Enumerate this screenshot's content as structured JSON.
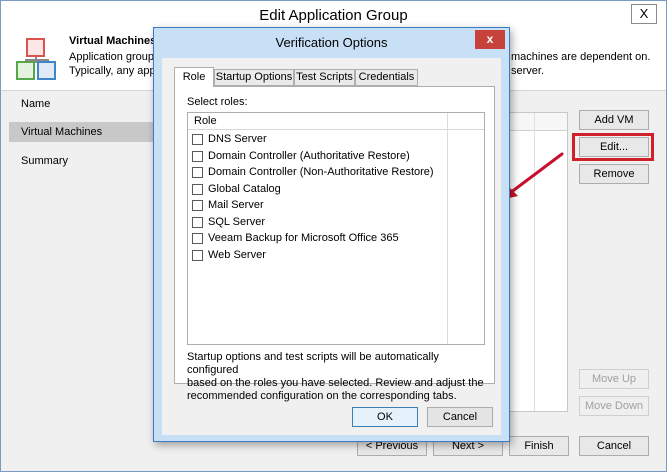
{
  "window": {
    "title": "Edit Application Group",
    "close_glyph": "X"
  },
  "header": {
    "title": "Virtual Machines",
    "description_line1": "Application group",
    "description_line2": "Typically, any appl",
    "description_right1": "machines are dependent on.",
    "description_right2": "server.",
    "icon": "application-group-icon"
  },
  "nav": {
    "items": [
      {
        "label": "Name"
      },
      {
        "label": "Virtual Machines",
        "selected": true
      },
      {
        "label": "Summary"
      }
    ]
  },
  "side_buttons": {
    "add_vm": "Add VM",
    "edit": "Edit...",
    "remove": "Remove",
    "move_up": "Move Up",
    "move_down": "Move Down"
  },
  "footer": {
    "previous": "< Previous",
    "next": "Next >",
    "finish": "Finish",
    "cancel": "Cancel"
  },
  "annotation": {
    "highlight_color": "#d0202a",
    "arrow_color": "#c8102e"
  },
  "dialog": {
    "title": "Verification Options",
    "close_glyph": "x",
    "tabs": [
      {
        "label": "Role",
        "active": true
      },
      {
        "label": "Startup Options"
      },
      {
        "label": "Test Scripts"
      },
      {
        "label": "Credentials"
      }
    ],
    "select_roles_label": "Select roles:",
    "column_header": "Role",
    "roles": [
      {
        "label": "DNS Server",
        "checked": false
      },
      {
        "label": "Domain Controller (Authoritative Restore)",
        "checked": false
      },
      {
        "label": "Domain Controller (Non-Authoritative Restore)",
        "checked": false
      },
      {
        "label": "Global Catalog",
        "checked": false
      },
      {
        "label": "Mail Server",
        "checked": false
      },
      {
        "label": "SQL Server",
        "checked": false
      },
      {
        "label": "Veeam Backup for Microsoft Office 365",
        "checked": false
      },
      {
        "label": "Web Server",
        "checked": false
      }
    ],
    "note_line1": "Startup options and test scripts will be automatically configured",
    "note_line2": "based on the roles you have selected. Review and adjust the",
    "note_line3": "recommended configuration on the corresponding tabs.",
    "ok": "OK",
    "cancel": "Cancel"
  },
  "colors": {
    "dialog_frame": "#c7e0f5",
    "dialog_close": "#c7423a",
    "selected_nav": "#c8c8c8"
  }
}
